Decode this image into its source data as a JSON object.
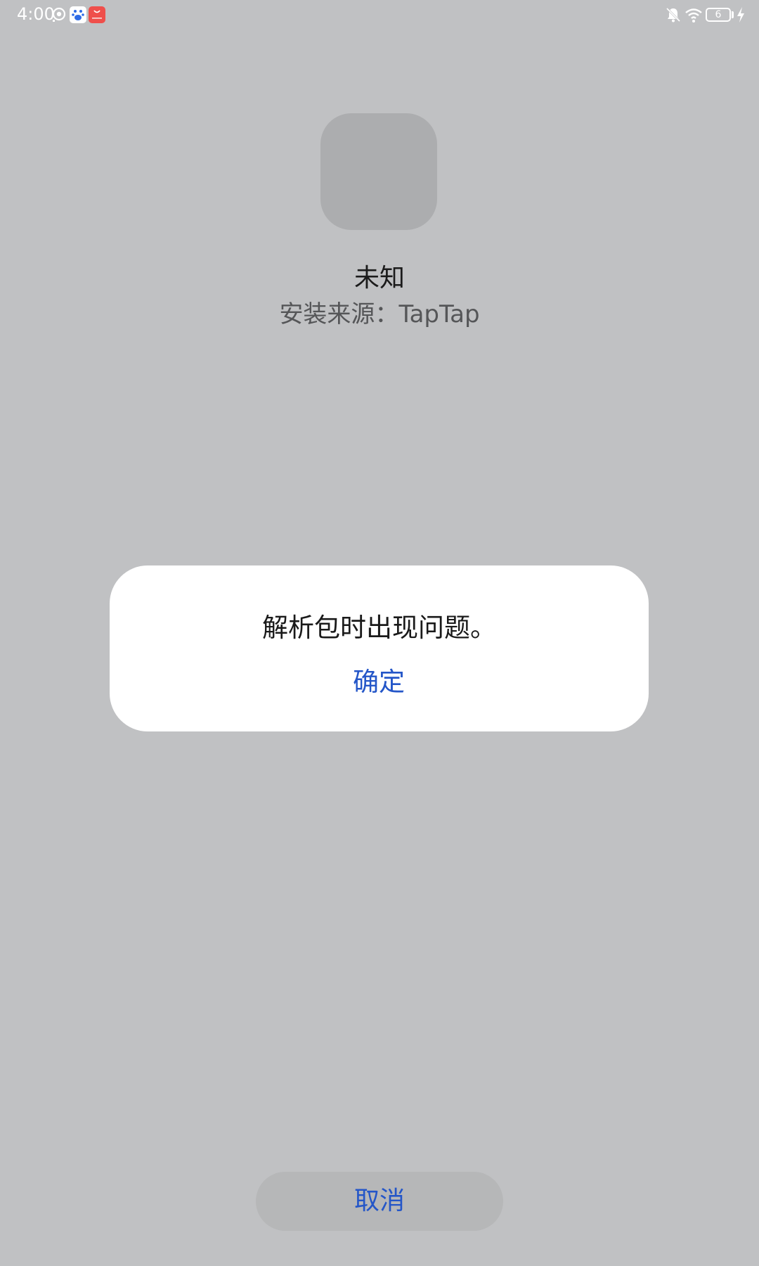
{
  "status_bar": {
    "time": "4:00",
    "battery_level": "6",
    "icons": [
      "location-icon",
      "baidu-app-icon",
      "red-app-icon",
      "bell-off-icon",
      "wifi-icon",
      "battery-icon",
      "charging-icon"
    ]
  },
  "app": {
    "name": "未知",
    "source_label": "安装来源：",
    "source_value": "TapTap"
  },
  "dialog": {
    "message": "解析包时出现问题。",
    "confirm_label": "确定"
  },
  "footer": {
    "cancel_label": "取消"
  },
  "colors": {
    "background": "#c0c1c3",
    "accent": "#2456c8",
    "dialog": "#ffffff",
    "icon_placeholder": "#acadaf"
  }
}
